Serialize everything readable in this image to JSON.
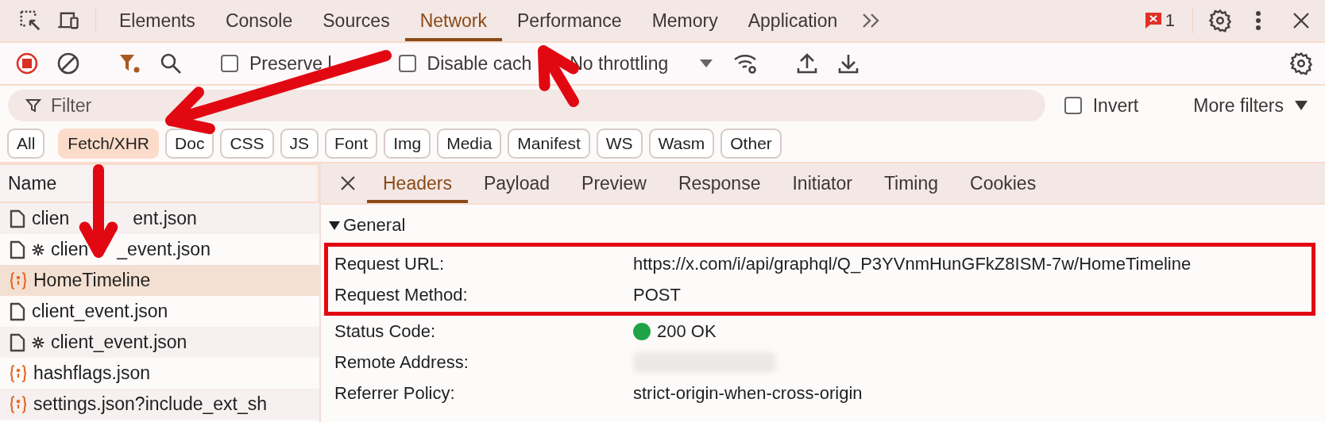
{
  "main_tabs": [
    {
      "label": "Elements",
      "selected": false
    },
    {
      "label": "Console",
      "selected": false
    },
    {
      "label": "Sources",
      "selected": false
    },
    {
      "label": "Network",
      "selected": true
    },
    {
      "label": "Performance",
      "selected": false
    },
    {
      "label": "Memory",
      "selected": false
    },
    {
      "label": "Application",
      "selected": false
    }
  ],
  "issues": {
    "count": "1"
  },
  "toolbar": {
    "recording": true,
    "options": [
      {
        "label": "Preserve l",
        "checked": false
      },
      {
        "label": "Disable cach",
        "checked": false
      }
    ],
    "throttling": "No throttling"
  },
  "filter": {
    "placeholder": "Filter",
    "invert": {
      "label": "Invert",
      "checked": false
    },
    "more_filters": "More filters"
  },
  "type_filters": [
    {
      "label": "All",
      "selected": false
    },
    {
      "label": "Fetch/XHR",
      "selected": true
    },
    {
      "label": "Doc",
      "selected": false
    },
    {
      "label": "CSS",
      "selected": false
    },
    {
      "label": "JS",
      "selected": false
    },
    {
      "label": "Font",
      "selected": false
    },
    {
      "label": "Img",
      "selected": false
    },
    {
      "label": "Media",
      "selected": false
    },
    {
      "label": "Manifest",
      "selected": false
    },
    {
      "label": "WS",
      "selected": false
    },
    {
      "label": "Wasm",
      "selected": false
    },
    {
      "label": "Other",
      "selected": false
    }
  ],
  "requests": {
    "column": "Name",
    "rows": [
      {
        "name_parts": [
          "clien",
          "ent.json"
        ],
        "kind": "document",
        "service_worker": false,
        "selected": false
      },
      {
        "name_parts": [
          "clien",
          "_event.json"
        ],
        "kind": "document",
        "service_worker": true,
        "selected": false
      },
      {
        "name": "HomeTimeline",
        "kind": "fetch",
        "service_worker": false,
        "selected": true
      },
      {
        "name": "client_event.json",
        "kind": "document",
        "service_worker": false,
        "selected": false
      },
      {
        "name": "client_event.json",
        "kind": "document",
        "service_worker": true,
        "selected": false
      },
      {
        "name": "hashflags.json",
        "kind": "fetch",
        "service_worker": false,
        "selected": false
      },
      {
        "name": "settings.json?include_ext_sh",
        "kind": "fetch",
        "service_worker": false,
        "selected": false
      }
    ]
  },
  "details": {
    "tabs": [
      {
        "label": "Headers",
        "selected": true
      },
      {
        "label": "Payload",
        "selected": false
      },
      {
        "label": "Preview",
        "selected": false
      },
      {
        "label": "Response",
        "selected": false
      },
      {
        "label": "Initiator",
        "selected": false
      },
      {
        "label": "Timing",
        "selected": false
      },
      {
        "label": "Cookies",
        "selected": false
      }
    ],
    "section": {
      "title": "General",
      "expanded": true,
      "fields": [
        {
          "label": "Request URL:",
          "value": "https://x.com/i/api/graphql/Q_P3YVnmHunGFkZ8ISM-7w/HomeTimeline",
          "highlighted": true
        },
        {
          "label": "Request Method:",
          "value": "POST",
          "highlighted": true
        },
        {
          "label": "Status Code:",
          "value": "200 OK",
          "color": "#1ea446",
          "highlighted": false
        },
        {
          "label": "Remote Address:",
          "redacted": true,
          "highlighted": false
        },
        {
          "label": "Referrer Policy:",
          "value": "strict-origin-when-cross-origin",
          "highlighted": false
        }
      ]
    }
  }
}
